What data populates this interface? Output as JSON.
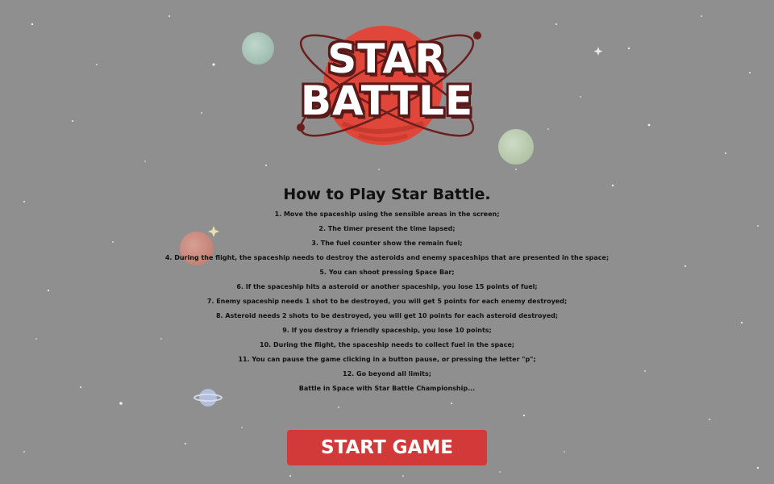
{
  "logo": {
    "line1": "STAR",
    "line2": "BATTLE"
  },
  "instructions": {
    "title": "How to Play Star Battle.",
    "rules": [
      "1. Move the spaceship using the sensible areas in the screen;",
      "2. The timer present the time lapsed;",
      "3. The fuel counter show the remain fuel;",
      "4. During the flight, the spaceship needs to destroy the asteroids and enemy spaceships that are presented in the space;",
      "5. You can shoot pressing Space Bar;",
      "6. If the spaceship hits a asteroid or another spaceship, you lose 15 points of fuel;",
      "7. Enemy spaceship needs 1 shot to be destroyed, you will get 5 points for each enemy destroyed;",
      "8. Asteroid needs 2 shots to be destroyed, you will get 10 points for each asteroid destroyed;",
      "9. If you destroy a friendly spaceship, you lose 10 points;",
      "10. During the flight, the spaceship needs to collect fuel in the space;",
      "11. You can pause the game clicking in a button pause, or pressing the letter \"p\";",
      "12. Go beyond all limits;",
      "Battle in Space with Star Battle Championship..."
    ]
  },
  "start_button": {
    "label": "START GAME"
  },
  "colors": {
    "background": "#8f8f8f",
    "logo_planet": "#e0473a",
    "logo_outline": "#5a1a1a",
    "button": "#d23a3a",
    "button_text": "#ffffff",
    "text": "#111111"
  }
}
